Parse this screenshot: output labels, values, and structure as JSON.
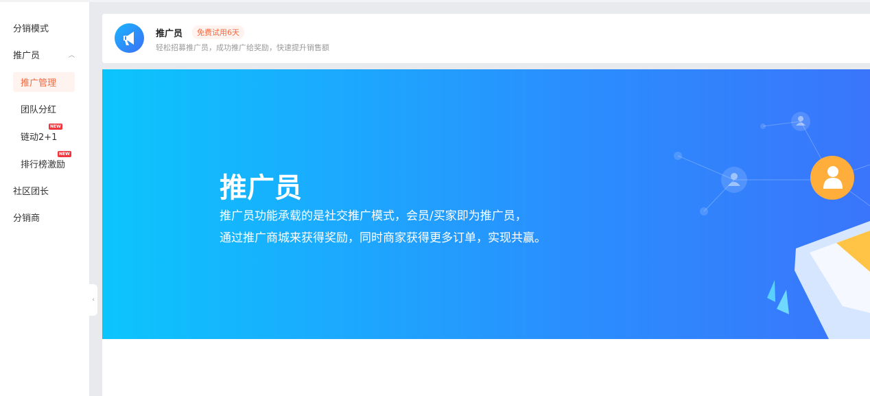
{
  "sidebar": {
    "items": [
      {
        "label": "分销模式"
      },
      {
        "label": "推广员",
        "expanded": true
      },
      {
        "label": "推广管理",
        "active": true
      },
      {
        "label": "团队分红"
      },
      {
        "label": "链动2+1",
        "badge": "NEW"
      },
      {
        "label": "排行榜激励",
        "badge": "NEW"
      },
      {
        "label": "社区团长"
      },
      {
        "label": "分销商"
      }
    ]
  },
  "header": {
    "title": "推广员",
    "trial": "免费试用6天",
    "desc": "轻松招募推广员，成功推广给奖励，快速提升销售额"
  },
  "banner": {
    "title": "推广员",
    "line1": "推广员功能承载的是社交推广模式，会员/买家即为推广员，",
    "line2": "通过推广商城来获得奖励，同时商家获得更多订单，实现共赢。"
  },
  "colors": {
    "accent": "#f5683d",
    "banner_start": "#0cc5fd",
    "banner_end": "#3a75fb"
  }
}
